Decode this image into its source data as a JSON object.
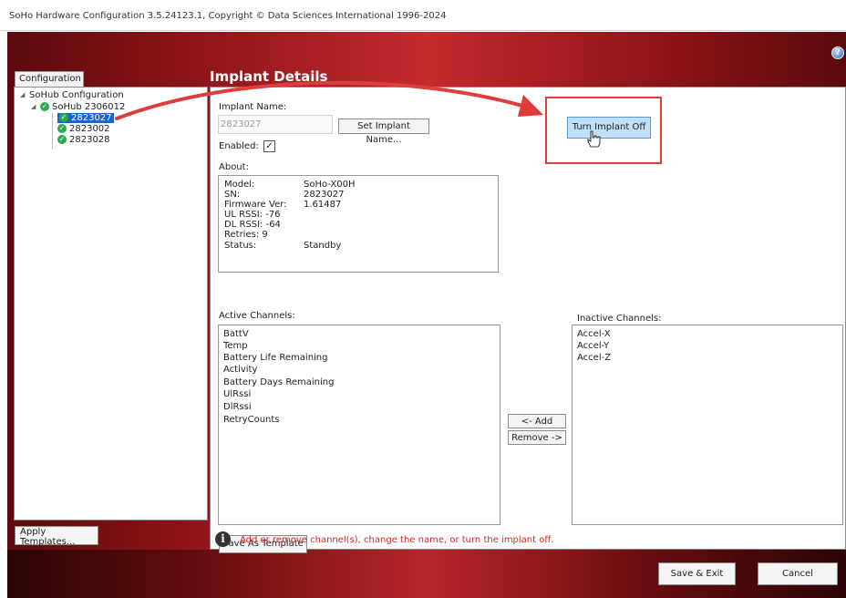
{
  "window": {
    "title": "SoHo Hardware Configuration 3.5.24123.1, Copyright © Data Sciences International 1996-2024"
  },
  "sidebar": {
    "tab_label": "Configuration",
    "tree": {
      "root": "SoHub Configuration",
      "hub": "SoHub 2306012",
      "implants": [
        "2823027",
        "2823002",
        "2823028"
      ]
    },
    "apply_templates_label": "Apply Templates..."
  },
  "main": {
    "heading": "Implant Details",
    "implant_name_label": "Implant Name:",
    "implant_name_value": "2823027",
    "set_name_button": "Set Implant Name...",
    "enabled_label": "Enabled:",
    "enabled_mark": "✓",
    "about_label": "About:",
    "about": [
      {
        "key": "Model:",
        "value": "SoHo-X00H"
      },
      {
        "key": "SN:",
        "value": "2823027"
      },
      {
        "key": "Firmware Ver:",
        "value": "1.61487"
      },
      {
        "key": "UL RSSI: -76",
        "value": ""
      },
      {
        "key": "DL RSSI: -64",
        "value": ""
      },
      {
        "key": "Retries: 9",
        "value": ""
      },
      {
        "key": "Status:",
        "value": "Standby"
      }
    ],
    "active_channels_label": "Active Channels:",
    "active_channels": [
      "BattV",
      "Temp",
      "Battery Life Remaining",
      "Activity",
      "Battery Days Remaining",
      "UlRssi",
      "DlRssi",
      "RetryCounts"
    ],
    "inactive_channels_label": "Inactive Channels:",
    "inactive_channels": [
      "Accel-X",
      "Accel-Y",
      "Accel-Z"
    ],
    "add_button": "<- Add",
    "remove_button": "Remove ->",
    "turn_off_button": "Turn Implant Off",
    "save_template_button": "Save As Template",
    "info_text": "Add or remove channel(s), change the name, or turn the implant off."
  },
  "footer": {
    "save_exit_button": "Save & Exit",
    "cancel_button": "Cancel"
  },
  "colors": {
    "accent_red": "#c42a2e",
    "selection_blue": "#1a66cc",
    "status_green": "#2ea84f",
    "annotation_red": "#e03c3c"
  }
}
